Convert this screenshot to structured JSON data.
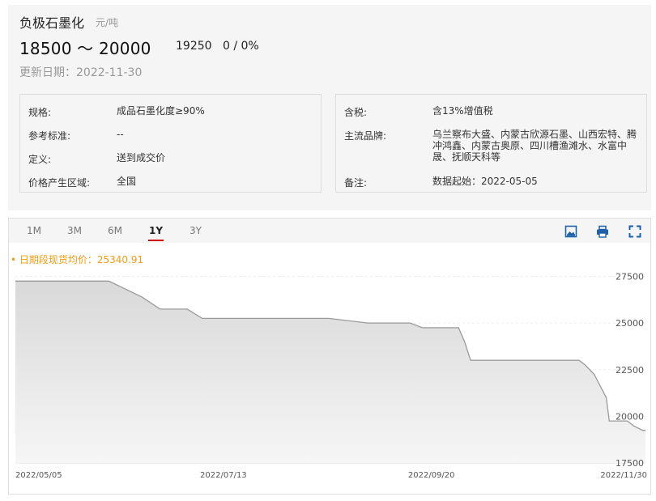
{
  "product": {
    "name": "负极石墨化",
    "unit": "元/吨",
    "price_range": "18500 ～ 20000",
    "avg_price": "19250",
    "change": "0 / 0%",
    "update_date": "更新日期：2022-11-30"
  },
  "info_left": [
    {
      "label": "规格:",
      "value": "成品石墨化度≥90%"
    },
    {
      "label": "参考标准:",
      "value": "--"
    },
    {
      "label": "定义:",
      "value": "送到成交价"
    },
    {
      "label": "价格产生区域:",
      "value": "全国"
    }
  ],
  "info_right": [
    {
      "label": "含税:",
      "value": "含13%增值税"
    },
    {
      "label": "主流品牌:",
      "value": "乌兰察布大盛、内蒙古欣源石墨、山西宏特、腾冲鸿鑫、内蒙古奥原、四川槽渔滩水、水富中晟、抚顺天科等"
    },
    {
      "label": "备注:",
      "value": "数据起始：2022-05-05"
    }
  ],
  "tabs": [
    "1M",
    "3M",
    "6M",
    "1Y",
    "3Y"
  ],
  "active_tab": "1Y",
  "icons": [
    "download-image-icon",
    "print-icon",
    "fullscreen-icon"
  ],
  "chart_data": {
    "type": "area",
    "annotation": "• 日期段现货均价：25340.91",
    "x_ticks": [
      "2022/05/05",
      "2022/07/13",
      "2022/09/20",
      "2022/11/30"
    ],
    "y_ticks": [
      17500,
      20000,
      22500,
      25000,
      27500
    ],
    "ylim": [
      17500,
      28000
    ],
    "x": [
      "2022-05-05",
      "2022-06-05",
      "2022-06-16",
      "2022-06-22",
      "2022-07-01",
      "2022-07-06",
      "2022-08-15",
      "2022-08-17",
      "2022-08-30",
      "2022-09-01",
      "2022-09-13",
      "2022-09-17",
      "2022-09-29",
      "2022-10-01",
      "2022-10-03",
      "2022-11-08",
      "2022-11-10",
      "2022-11-13",
      "2022-11-17",
      "2022-11-18",
      "2022-11-24",
      "2022-11-26",
      "2022-11-29",
      "2022-11-30"
    ],
    "values": [
      27250,
      27250,
      26400,
      25750,
      25750,
      25250,
      25250,
      25250,
      25000,
      25000,
      25000,
      24750,
      24750,
      24000,
      23000,
      23000,
      22750,
      22250,
      21000,
      19750,
      19750,
      19500,
      19250,
      19250
    ],
    "colors": {
      "line": "#9a9a9a",
      "fill_top": "#d9d9d9",
      "fill_bottom": "#f6f6f6",
      "annotation": "#f39c12",
      "active_tab": "#d00000"
    }
  }
}
